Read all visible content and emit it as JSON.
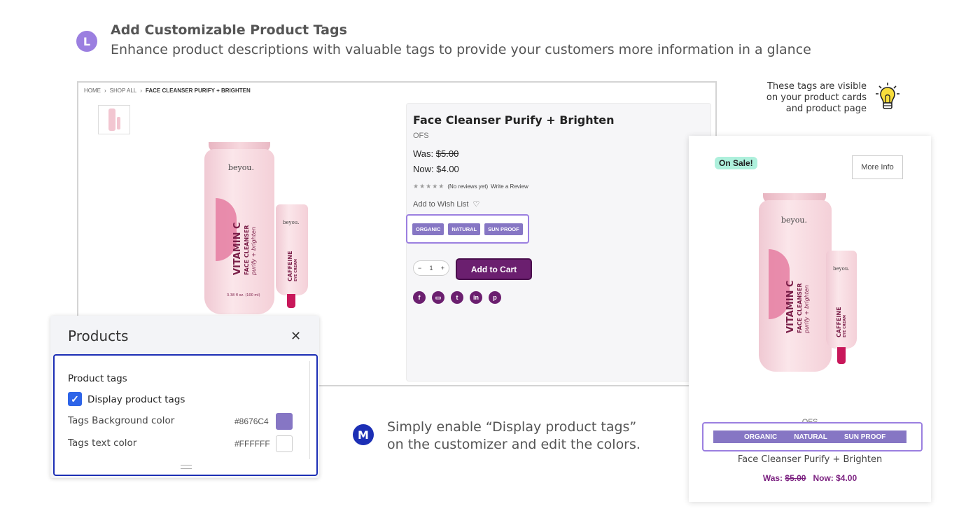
{
  "header": {
    "badge": "L",
    "title": "Add Customizable Product Tags",
    "subtitle": "Enhance product descriptions with valuable tags to provide your customers more information in a glance"
  },
  "product_page": {
    "breadcrumb": [
      "HOME",
      "SHOP ALL",
      "FACE CLEANSER PURIFY + BRIGHTEN"
    ],
    "title": "Face Cleanser Purify + Brighten",
    "brand": "OFS",
    "was_label": "Was:",
    "was_price": "$5.00",
    "now_label": "Now:",
    "now_price": "$4.00",
    "reviews": "(No reviews yet)",
    "write_review": "Write a Review",
    "wishlist": "Add to Wish List",
    "tags": [
      "ORGANIC",
      "NATURAL",
      "SUN PROOF"
    ],
    "quantity": "1",
    "add_to_cart": "Add to Cart",
    "share_icons": [
      "facebook-icon",
      "print-icon",
      "twitter-icon",
      "linkedin-icon",
      "pinterest-icon"
    ]
  },
  "artwork": {
    "tube_brand": "beyou.",
    "tube_line1": "VITAMIN C",
    "tube_line2": "FACE CLEANSER",
    "tube_line3": "purify + brighten",
    "tube_volume": "3.38 fl oz. (100 ml)",
    "small_line1": "CAFFEINE",
    "small_line2": "EYE CREAM"
  },
  "tip": {
    "line1": "These tags are visible",
    "line2": "on your product cards",
    "line3": "and product page",
    "icon": "lightbulb-icon"
  },
  "product_card": {
    "sale_badge": "On Sale!",
    "more_info": "More Info",
    "brand": "OFS",
    "tags": [
      "ORGANIC",
      "NATURAL",
      "SUN PROOF"
    ],
    "name": "Face Cleanser Purify + Brighten",
    "was_label": "Was:",
    "was_price": "$5.00",
    "now_label": "Now:",
    "now_price": "$4.00"
  },
  "customizer": {
    "title": "Products",
    "section_title": "Product tags",
    "checkbox_label": "Display product tags",
    "checkbox_checked": true,
    "bg_label": "Tags Background color",
    "bg_value": "#8676C4",
    "text_label": "Tags text color",
    "text_value": "#FFFFFF"
  },
  "step_m": {
    "badge": "M",
    "line1": "Simply enable “Display product tags”",
    "line2": "on the customizer and edit the colors."
  },
  "colors": {
    "accent_purple": "#9b7fe0",
    "tag_bg": "#8676C4",
    "tag_text": "#FFFFFF",
    "cart_button": "#6b1f6f",
    "customizer_border": "#1c2fb5",
    "sale_badge": "#aef0dc"
  }
}
